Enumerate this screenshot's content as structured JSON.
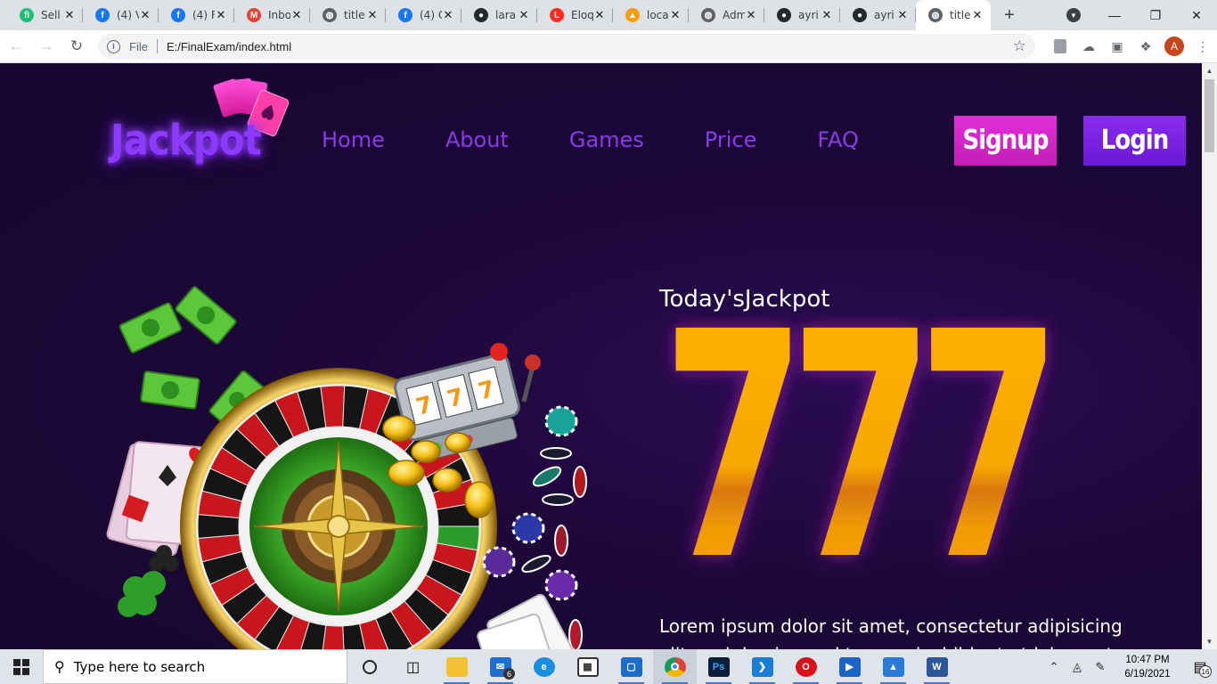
{
  "browser": {
    "tabs": [
      {
        "label": "Sell",
        "icon": "fiverr-icon",
        "color": "#1dbf73",
        "glyph": "fi"
      },
      {
        "label": "(4) V",
        "icon": "facebook-icon",
        "color": "#1877f2",
        "glyph": "f"
      },
      {
        "label": "(4) F",
        "icon": "facebook-icon",
        "color": "#1877f2",
        "glyph": "f"
      },
      {
        "label": "Inbo",
        "icon": "gmail-icon",
        "color": "#ea4335",
        "glyph": "M"
      },
      {
        "label": "title",
        "icon": "globe-icon",
        "color": "#5f6368",
        "glyph": "◍"
      },
      {
        "label": "(4) C",
        "icon": "facebook-icon",
        "color": "#1877f2",
        "glyph": "f"
      },
      {
        "label": "lara",
        "icon": "github-icon",
        "color": "#24292e",
        "glyph": "●"
      },
      {
        "label": "Eloq",
        "icon": "laravel-icon",
        "color": "#ff2d20",
        "glyph": "L"
      },
      {
        "label": "loca",
        "icon": "phpmyadmin-icon",
        "color": "#f89c0e",
        "glyph": "▲"
      },
      {
        "label": "Adm",
        "icon": "globe-icon",
        "color": "#5f6368",
        "glyph": "◍"
      },
      {
        "label": "ayri",
        "icon": "github-icon",
        "color": "#24292e",
        "glyph": "●"
      },
      {
        "label": "ayri",
        "icon": "github-icon",
        "color": "#24292e",
        "glyph": "●"
      },
      {
        "label": "title",
        "icon": "globe-icon",
        "color": "#5f6368",
        "glyph": "◍",
        "active": true
      }
    ],
    "address": {
      "scheme": "File",
      "url": "E:/FinalExam/index.html"
    },
    "profile_initial": "A"
  },
  "site": {
    "logo_text": "Jackpot",
    "nav": [
      {
        "label": "Home"
      },
      {
        "label": "About"
      },
      {
        "label": "Games"
      },
      {
        "label": "Price"
      },
      {
        "label": "FAQ"
      }
    ],
    "signup_label": "Signup",
    "login_label": "Login",
    "jackpot_title": "Today'sJackpot",
    "jackpot_number": "777",
    "lorem_line1": "Lorem ipsum dolor sit amet, consectetur adipisicing",
    "lorem_line2": "elit, sed do eiusmod tempor incididunt ut labore et",
    "colors": {
      "nav_text": "#8a3be8",
      "signup_bg": "#d324c8",
      "login_bg": "#7a22e4",
      "jackpot_gold": "#ffb300",
      "page_bg": "#1f0a3d"
    }
  },
  "taskbar": {
    "search_placeholder": "Type here to search",
    "apps": [
      {
        "name": "cortana-icon"
      },
      {
        "name": "task-view-icon"
      },
      {
        "name": "file-explorer-icon"
      },
      {
        "name": "mail-icon",
        "badge": "6"
      },
      {
        "name": "edge-icon"
      },
      {
        "name": "store-icon"
      },
      {
        "name": "terminal-icon"
      },
      {
        "name": "chrome-icon"
      },
      {
        "name": "photoshop-icon"
      },
      {
        "name": "vscode-icon"
      },
      {
        "name": "opera-icon"
      },
      {
        "name": "video-editor-icon"
      },
      {
        "name": "photos-icon"
      },
      {
        "name": "word-icon"
      }
    ],
    "time": "10:47 PM",
    "date": "6/19/2021",
    "notification_count": "16"
  }
}
